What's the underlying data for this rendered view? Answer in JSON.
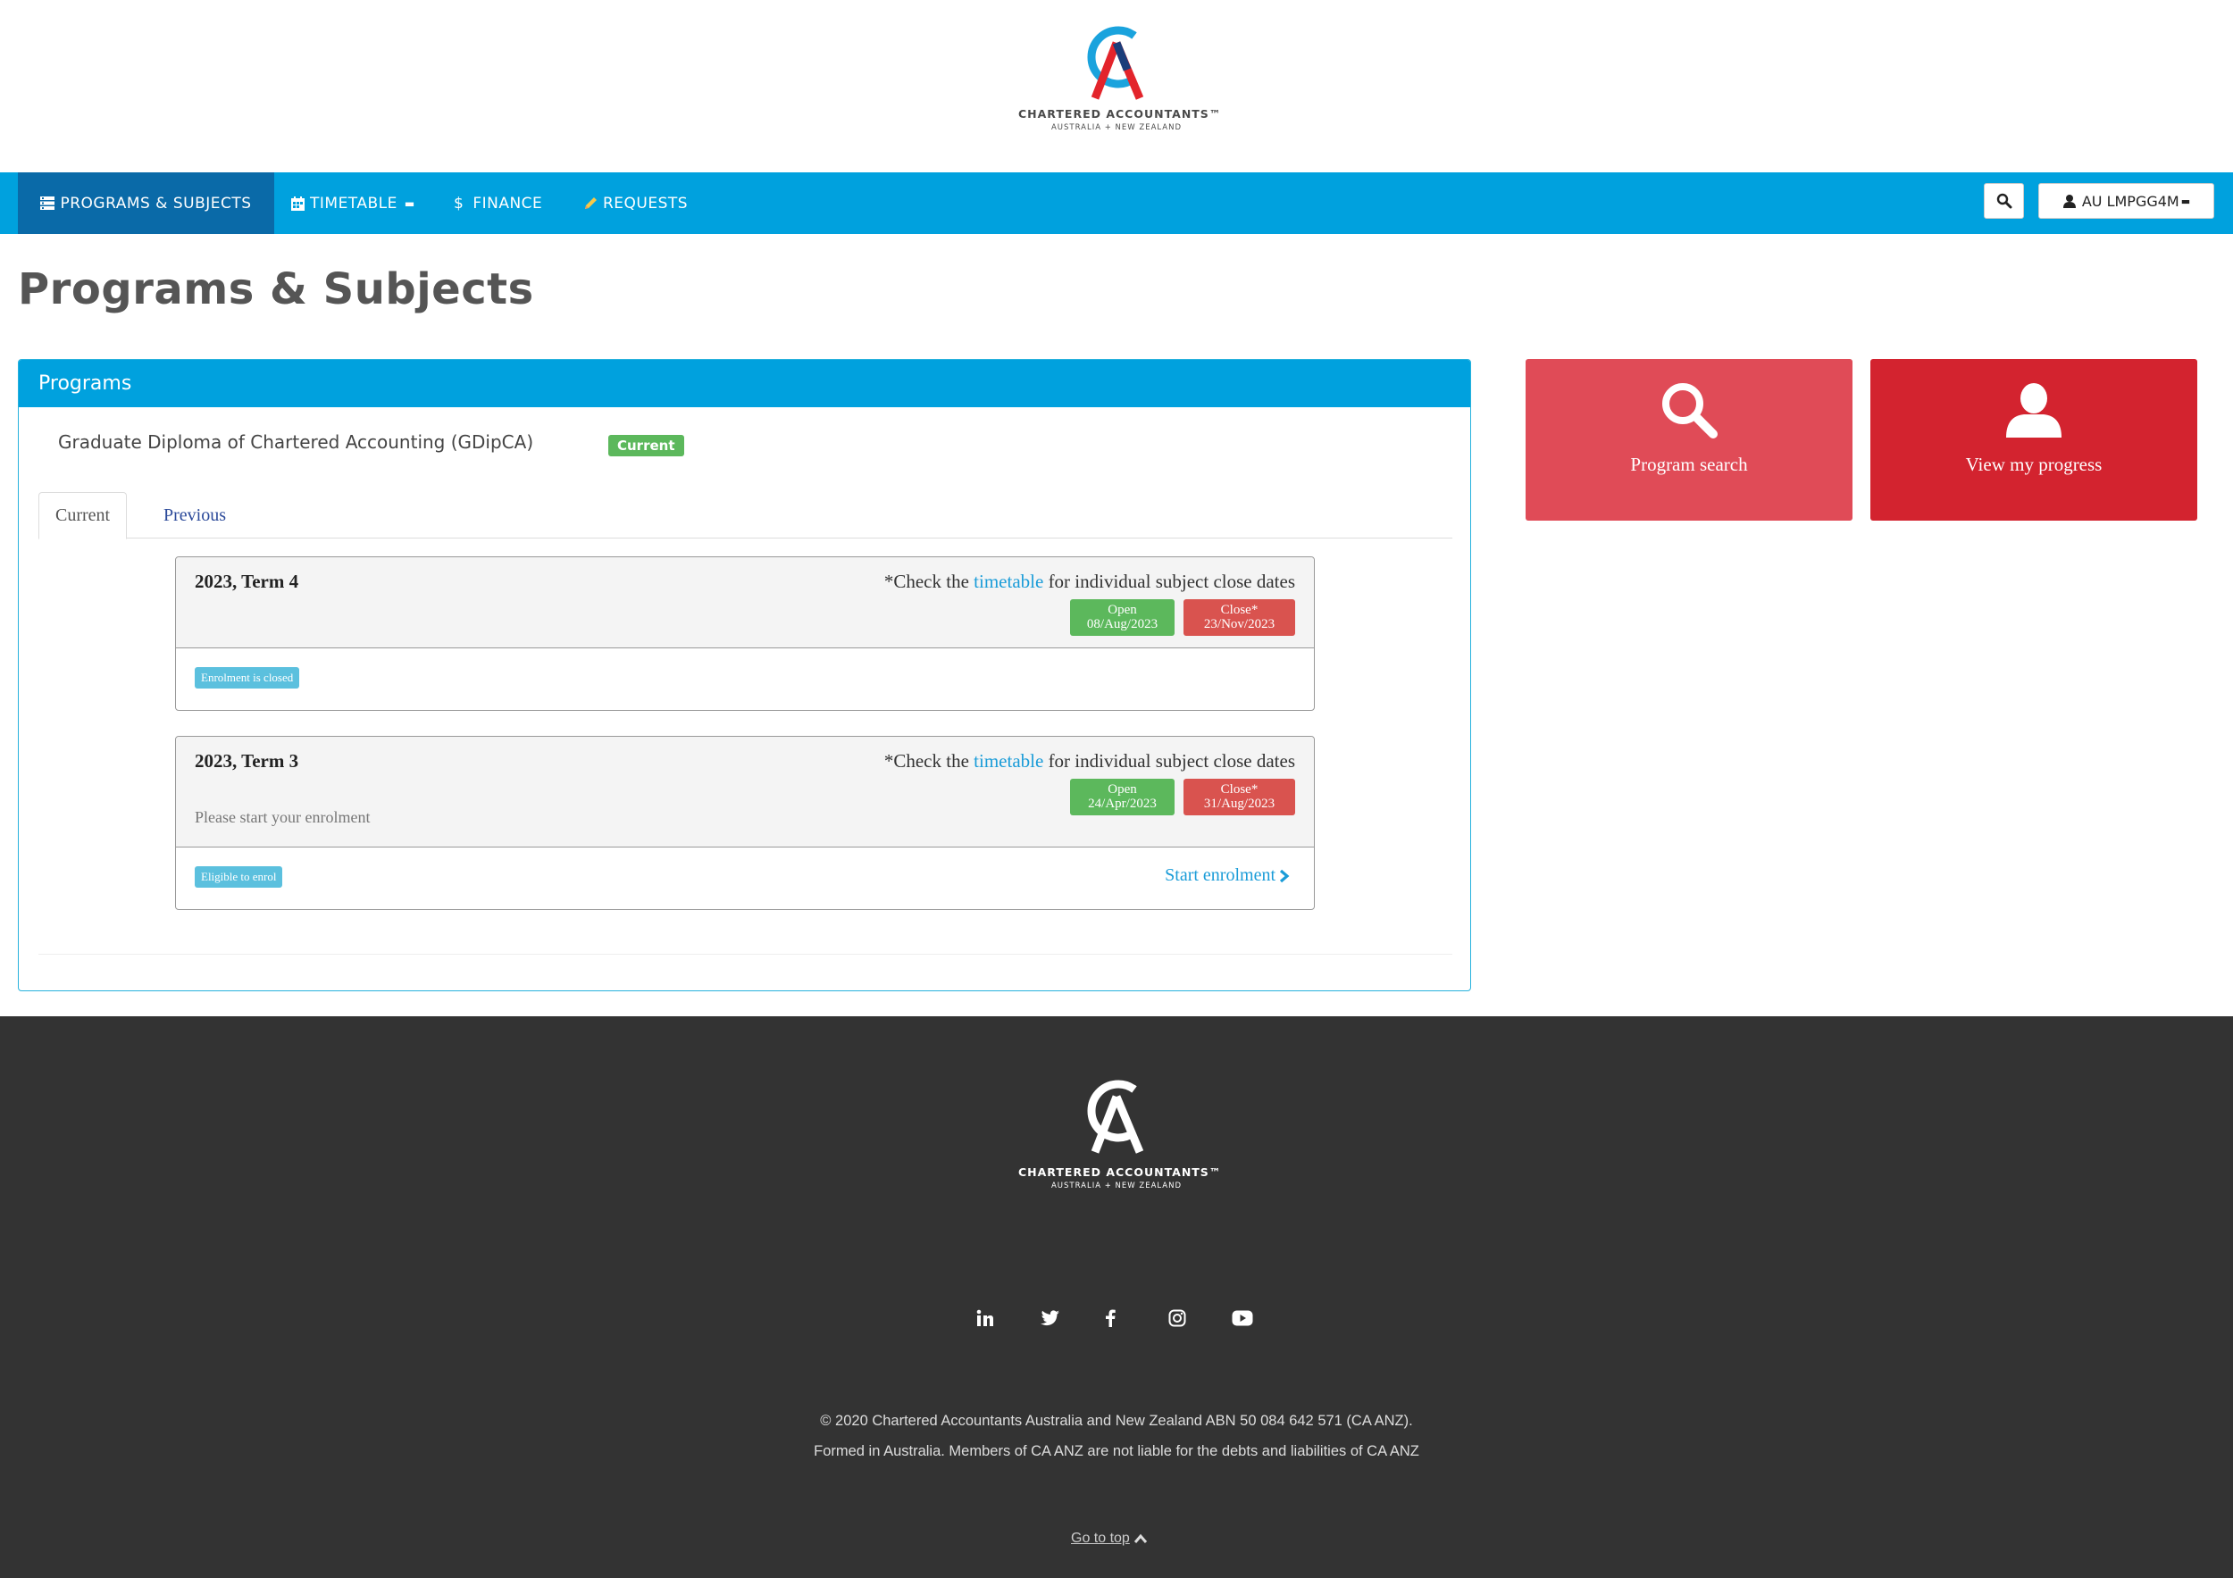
{
  "header": {
    "logo_title": "CHARTERED ACCOUNTANTS™",
    "logo_sub": "AUSTRALIA + NEW ZEALAND"
  },
  "nav": {
    "items": [
      {
        "label": "PROGRAMS & SUBJECTS",
        "icon": "list-icon",
        "active": true
      },
      {
        "label": "TIMETABLE",
        "icon": "calendar-icon"
      },
      {
        "label": "FINANCE",
        "icon": "dollar-icon"
      },
      {
        "label": "REQUESTS",
        "icon": "pencil-icon"
      }
    ],
    "user_label": "AU LMPGG4M"
  },
  "page": {
    "title": "Programs & Subjects"
  },
  "programs": {
    "heading": "Programs",
    "program_name": "Graduate Diploma of Chartered Accounting (GDipCA)",
    "program_status": "Current",
    "tabs": [
      "Current",
      "Previous"
    ],
    "terms": [
      {
        "name": "2023, Term 4",
        "note_prefix": "*Check the ",
        "note_link": "timetable",
        "note_suffix": " for individual subject close dates",
        "open_label": "Open",
        "open_date": "08/Aug/2023",
        "close_label": "Close*",
        "close_date": "23/Nov/2023",
        "message": "",
        "status": "Enrolment is closed",
        "action": ""
      },
      {
        "name": "2023, Term 3",
        "note_prefix": "*Check the ",
        "note_link": "timetable",
        "note_suffix": " for individual subject close dates",
        "open_label": "Open",
        "open_date": "24/Apr/2023",
        "close_label": "Close*",
        "close_date": "31/Aug/2023",
        "message": "Please start your enrolment",
        "status": "Eligible to enrol",
        "action": "Start enrolment"
      }
    ]
  },
  "tiles": {
    "search_label": "Program search",
    "progress_label": "View my progress"
  },
  "footer": {
    "logo_title": "CHARTERED ACCOUNTANTS™",
    "logo_sub": "AUSTRALIA + NEW ZEALAND",
    "social": [
      "linkedin-icon",
      "twitter-icon",
      "facebook-icon",
      "instagram-icon",
      "youtube-icon"
    ],
    "copyright_line1": "© 2020 Chartered Accountants Australia and New Zealand ABN 50 084 642 571 (CA ANZ).",
    "copyright_line2": "Formed in Australia. Members of CA ANZ are not liable for the debts and liabilities of CA ANZ",
    "go_to_top": "Go to top"
  },
  "colors": {
    "nav_blue": "#00a1de",
    "nav_active": "#0a6aa8",
    "green": "#5cb85c",
    "red": "#d9534f",
    "tile_red_light": "#e04b57",
    "tile_red_dark": "#d3232f",
    "footer_bg": "#333333"
  }
}
